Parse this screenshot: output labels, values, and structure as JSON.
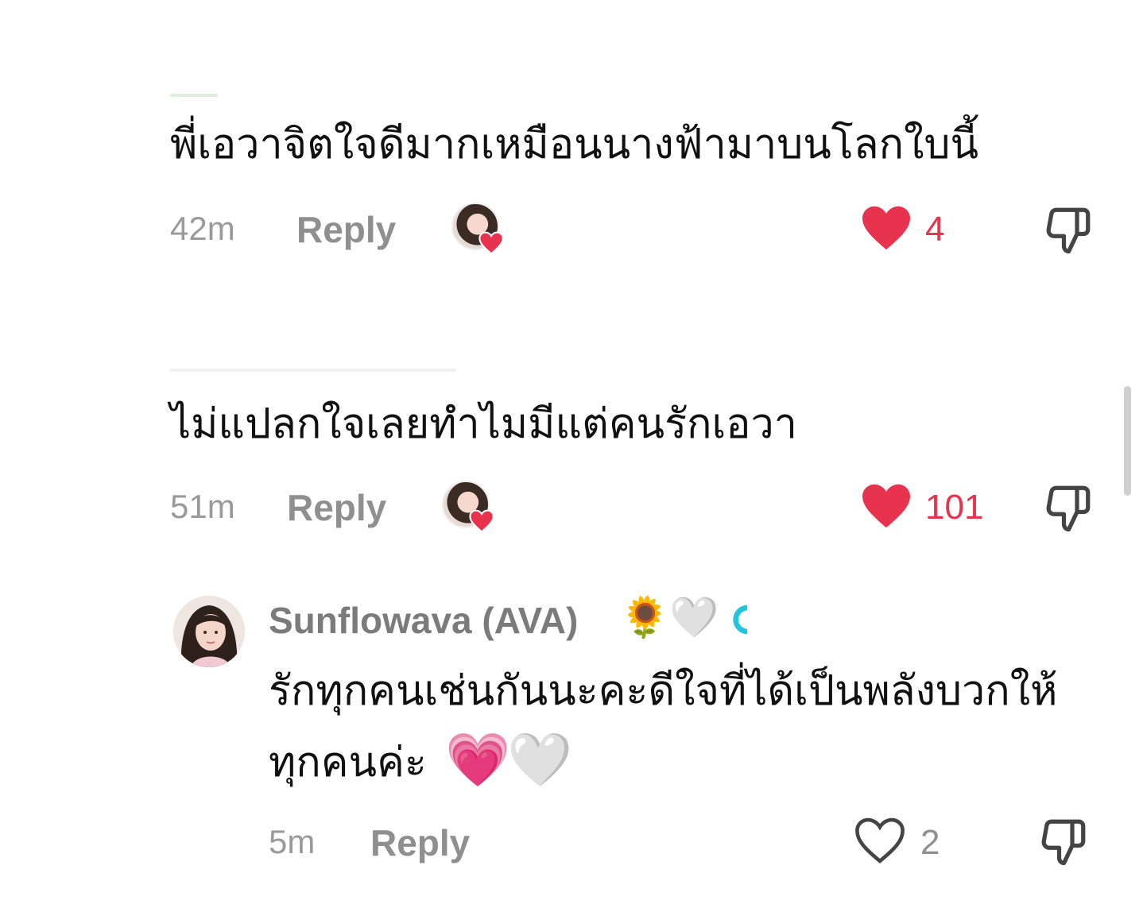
{
  "comments": [
    {
      "text": "พี่เอวาจิตใจดีมากเหมือนนางฟ้ามาบนโลกใบนี้",
      "time": "42m",
      "reply_label": "Reply",
      "likes": "4",
      "liked": true
    },
    {
      "text": "ไม่แปลกใจเลยทำไมมีแต่คนรักเอวา",
      "time": "51m",
      "reply_label": "Reply",
      "likes": "101",
      "liked": true
    }
  ],
  "reply": {
    "username": "Sunflowava (AVA)",
    "text_line1": "รักทุกคนเช่นกันนะคะดีใจที่ได้เป็นพลังบวกให้",
    "text_line2": "ทุกคนค่ะ",
    "time": "5m",
    "reply_label": "Reply",
    "likes": "2",
    "liked": false,
    "name_emojis": [
      "🌻",
      "🤍"
    ],
    "text_emojis": [
      "💗",
      "🤍"
    ]
  },
  "colors": {
    "like_red": "#e8334f",
    "meta_grey": "#9a9a9a"
  },
  "icons": {
    "like": "heart-icon",
    "dislike": "thumbs-down-icon",
    "creator_liked": "creator-liked-icon"
  }
}
